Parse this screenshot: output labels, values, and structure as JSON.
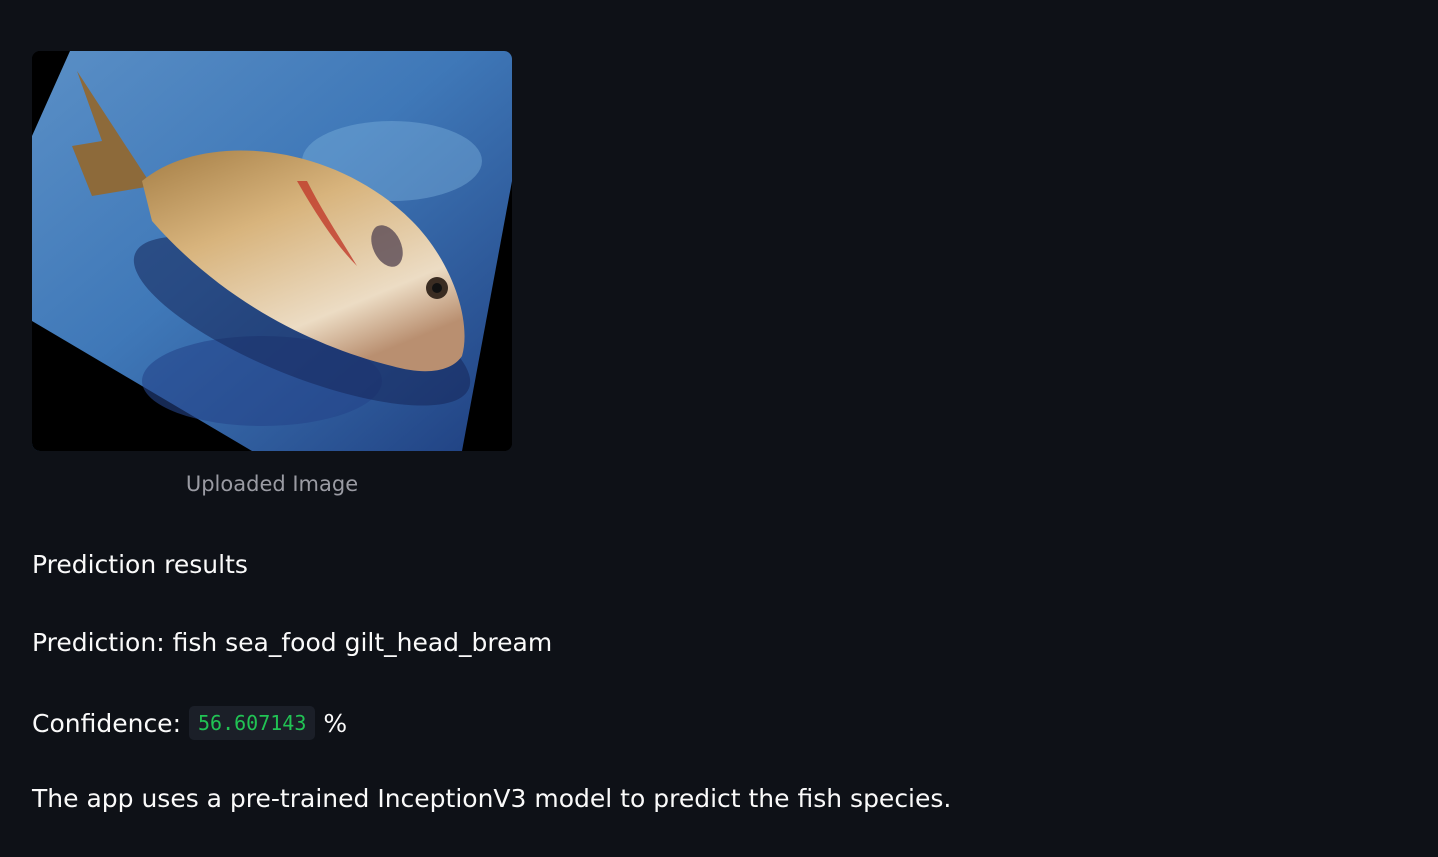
{
  "image": {
    "caption": "Uploaded Image",
    "alt": "fish on blue board"
  },
  "results": {
    "heading": "Prediction results",
    "prediction_label": "Prediction:",
    "prediction_value": "fish sea_food gilt_head_bream",
    "confidence_label": "Confidence:",
    "confidence_value": "56.607143",
    "confidence_unit": "%",
    "about": "The app uses a pre-trained InceptionV3 model to predict the fish species."
  },
  "colors": {
    "background": "#0e1117",
    "text": "#fafafa",
    "caption": "#9a9ba3",
    "code_bg": "#1b1f28",
    "code_text": "#21c354"
  }
}
